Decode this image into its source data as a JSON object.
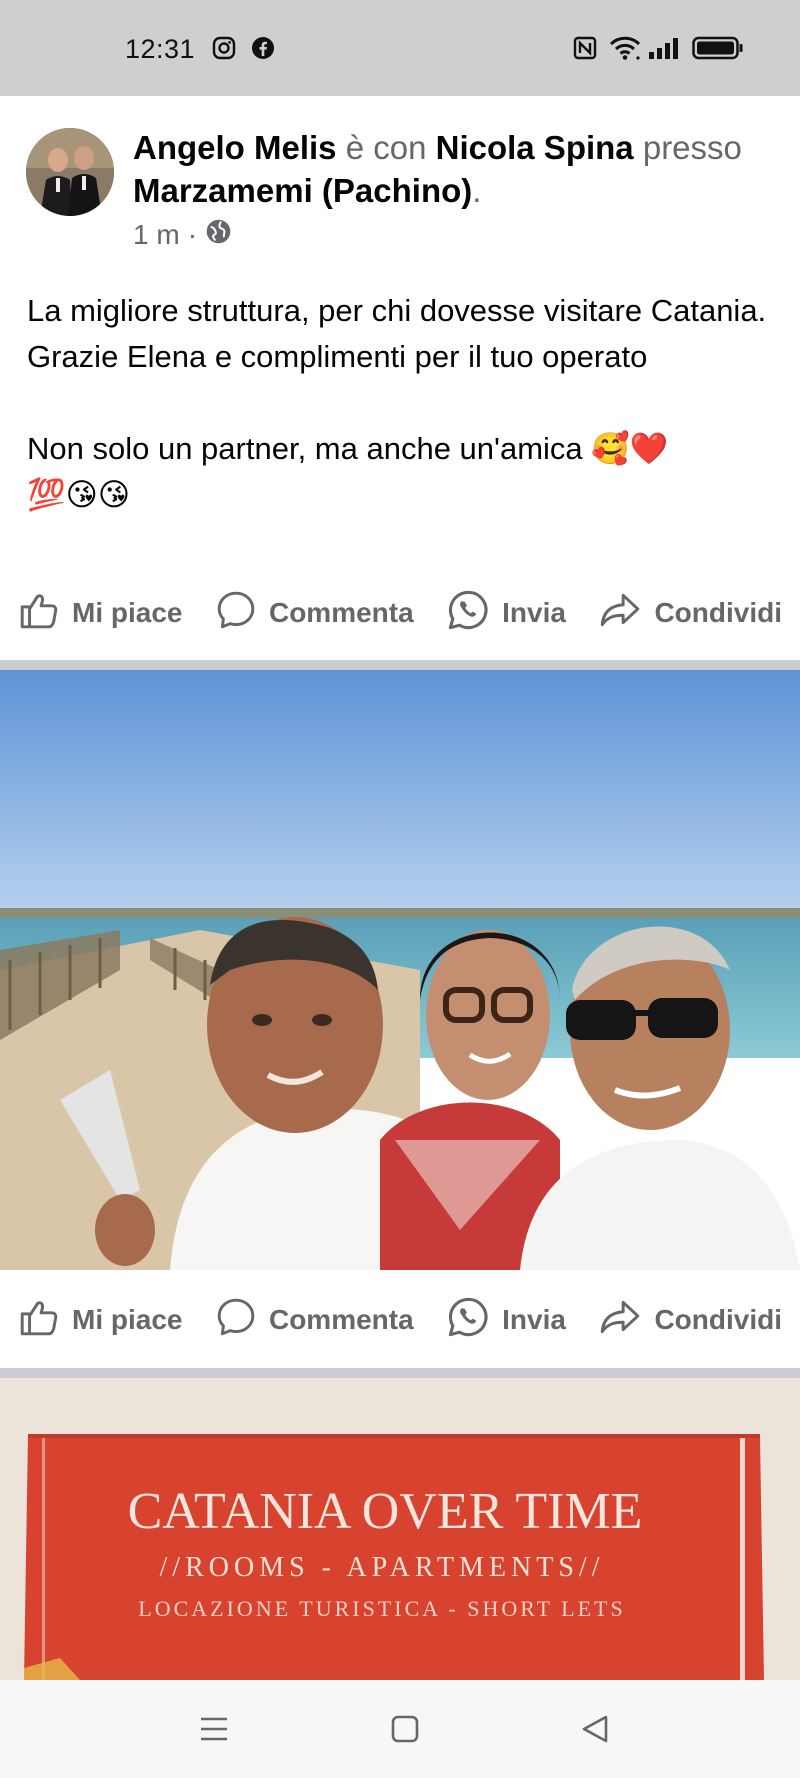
{
  "status_bar": {
    "time": "12:31",
    "left_icons": [
      "instagram-icon",
      "facebook-icon"
    ],
    "right_icons": [
      "nfc-icon",
      "wifi-icon",
      "signal-icon",
      "battery-icon"
    ]
  },
  "post": {
    "author": "Angelo Melis",
    "with_text": "è con",
    "tagged": "Nicola Spina",
    "at_text": "presso",
    "place": "Marzamemi (Pachino)",
    "period": ".",
    "time": "1 m",
    "separator": "·",
    "privacy_icon": "globe-icon",
    "text_lines": [
      "La migliore struttura, per chi dovesse visitare Catania.",
      "Grazie Elena e complimenti per il tuo operato",
      "",
      "Non solo un partner, ma anche un'amica"
    ],
    "emojis_line1": "🥰❤️",
    "emojis_line2": "💯😘😘"
  },
  "actions": {
    "like": "Mi piace",
    "comment": "Commenta",
    "send": "Invia",
    "share": "Condividi"
  },
  "sign": {
    "title": "CATANIA OVER TIME",
    "subtitle": "//ROOMS - APARTMENTS//",
    "tagline": "LOCAZIONE TURISTICA - SHORT LETS"
  },
  "nav_bar": {
    "icons": [
      "menu-icon",
      "home-square-icon",
      "back-triangle-icon"
    ]
  },
  "colors": {
    "status_bg": "#cfcfd1",
    "secondary_text": "#65676b",
    "divider": "#c9ccd1",
    "sign_red": "#d8432f"
  }
}
